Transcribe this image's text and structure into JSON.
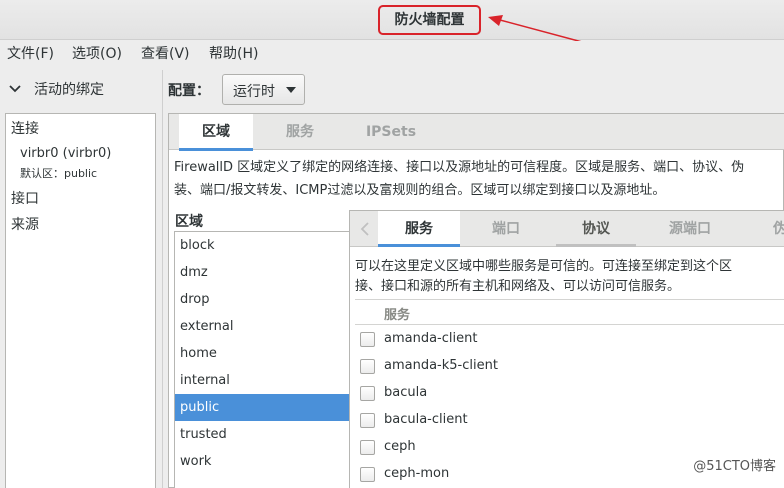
{
  "window": {
    "title": "防火墙配置"
  },
  "menu": [
    "文件(F)",
    "选项(O)",
    "查看(V)",
    "帮助(H)"
  ],
  "left_panel": {
    "header": "活动的绑定",
    "connection_label": "连接",
    "connection_name": "virbr0 (virbr0)",
    "connection_zone": "默认区：public",
    "interface_label": "接口",
    "source_label": "来源"
  },
  "config": {
    "label": "配置：",
    "selected": "运行时"
  },
  "main_tabs": [
    "区域",
    "服务",
    "IPSets"
  ],
  "zone_description": {
    "line1": "FirewallD 区域定义了绑定的网络连接、接口以及源地址的可信程度。区域是服务、端口、协议、伪",
    "line2": "装、端口/报文转发、ICMP过滤以及富规则的组合。区域可以绑定到接口以及源地址。"
  },
  "zones": {
    "label": "区域",
    "items": [
      "block",
      "dmz",
      "drop",
      "external",
      "home",
      "internal",
      "public",
      "trusted",
      "work"
    ],
    "selected": "public"
  },
  "inner_tabs": [
    "服务",
    "端口",
    "协议",
    "源端口",
    "伪"
  ],
  "services_description": {
    "line1": "可以在这里定义区域中哪些服务是可信的。可连接至绑定到这个区",
    "line2": "接、接口和源的所有主机和网络及、可以访问可信服务。"
  },
  "services": {
    "column": "服务",
    "items": [
      "amanda-client",
      "amanda-k5-client",
      "bacula",
      "bacula-client",
      "ceph",
      "ceph-mon"
    ]
  },
  "watermark": "@51CTO博客",
  "colors": {
    "selection": "#4a90d9",
    "annotation": "#d9232a"
  }
}
